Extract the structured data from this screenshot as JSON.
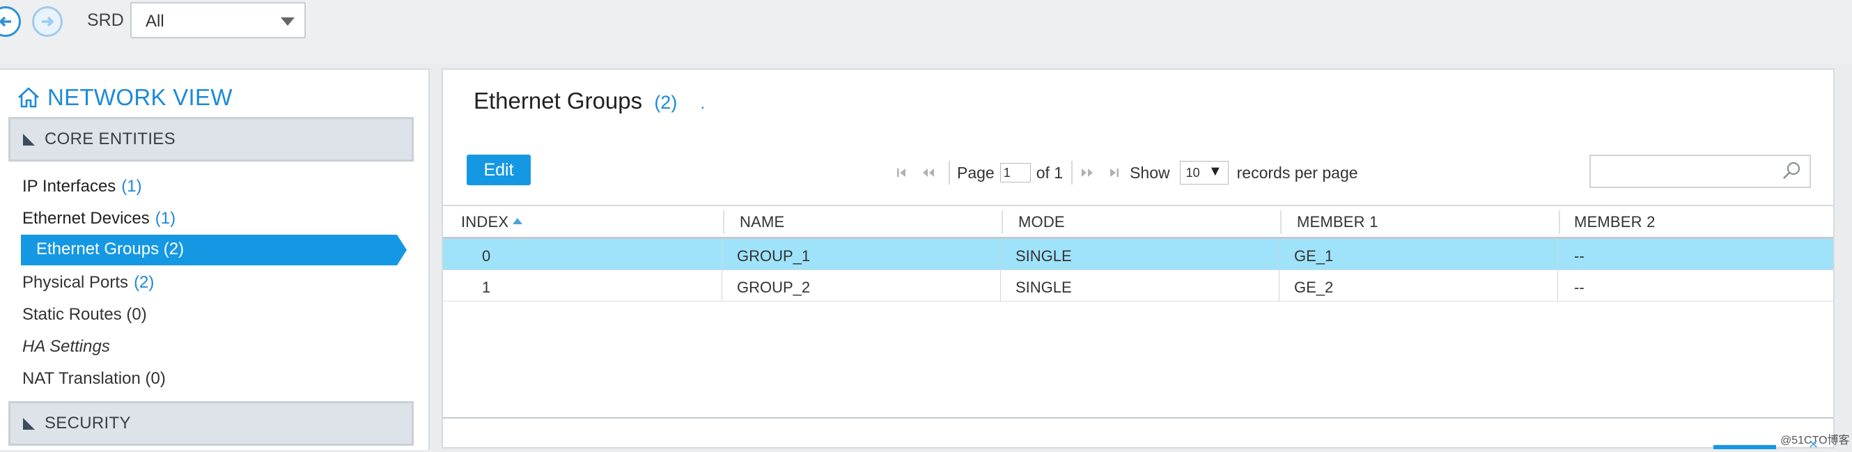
{
  "topbar": {
    "srd_label": "SRD",
    "srd_value": "All"
  },
  "sidebar": {
    "title": "NETWORK VIEW",
    "core_header": "CORE ENTITIES",
    "items": [
      {
        "label": "IP Interfaces",
        "count": "(1)"
      },
      {
        "label": "Ethernet Devices",
        "count": "(1)"
      },
      {
        "label": "Ethernet Groups (2)",
        "count": ""
      },
      {
        "label": "Physical Ports",
        "count": "(2)"
      },
      {
        "label": "Static Routes (0)",
        "count": ""
      },
      {
        "label": "HA Settings",
        "count": ""
      },
      {
        "label": "NAT Translation (0)",
        "count": ""
      }
    ],
    "security_header": "SECURITY"
  },
  "main": {
    "title": "Ethernet Groups",
    "title_count": "(2)",
    "title_dot": ".",
    "edit_label": "Edit",
    "pager": {
      "page_label": "Page",
      "page_value": "1",
      "of_label": "of 1",
      "show_label": "Show",
      "show_value": "10",
      "records_label": "records per page"
    },
    "columns": [
      "INDEX",
      "NAME",
      "MODE",
      "MEMBER 1",
      "MEMBER 2"
    ],
    "rows": [
      [
        "0",
        "GROUP_1",
        "SINGLE",
        "GE_1",
        "--"
      ],
      [
        "1",
        "GROUP_2",
        "SINGLE",
        "GE_2",
        "--"
      ]
    ]
  },
  "watermark": "@51CTO博客",
  "colors": {
    "accent": "#1598e4",
    "selected_row": "#9fe3fb",
    "link_blue": "#1c8ad8"
  }
}
